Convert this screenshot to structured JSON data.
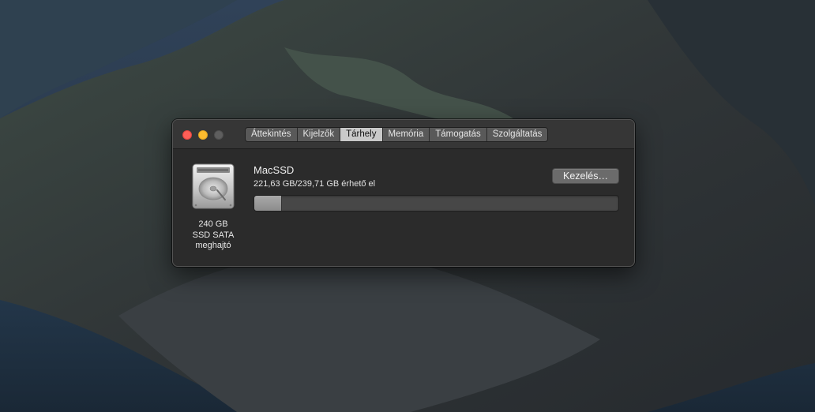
{
  "window": {
    "tabs": [
      {
        "label": "Áttekintés",
        "active": false
      },
      {
        "label": "Kijelzők",
        "active": false
      },
      {
        "label": "Tárhely",
        "active": true
      },
      {
        "label": "Memória",
        "active": false
      },
      {
        "label": "Támogatás",
        "active": false
      },
      {
        "label": "Szolgáltatás",
        "active": false
      }
    ]
  },
  "disk": {
    "icon": "hard-drive-icon",
    "label_line1": "240 GB",
    "label_line2": "SSD SATA",
    "label_line3": "meghajtó"
  },
  "volume": {
    "name": "MacSSD",
    "available_text": "221,63 GB/239,71 GB érhető el",
    "used_fraction": 0.0755
  },
  "manage_button": {
    "label": "Kezelés…"
  },
  "colors": {
    "close": "#fe5f57",
    "minimize": "#febc2e",
    "zoom": "#5e5e5e",
    "usage_fill": "#9a9a9a"
  }
}
